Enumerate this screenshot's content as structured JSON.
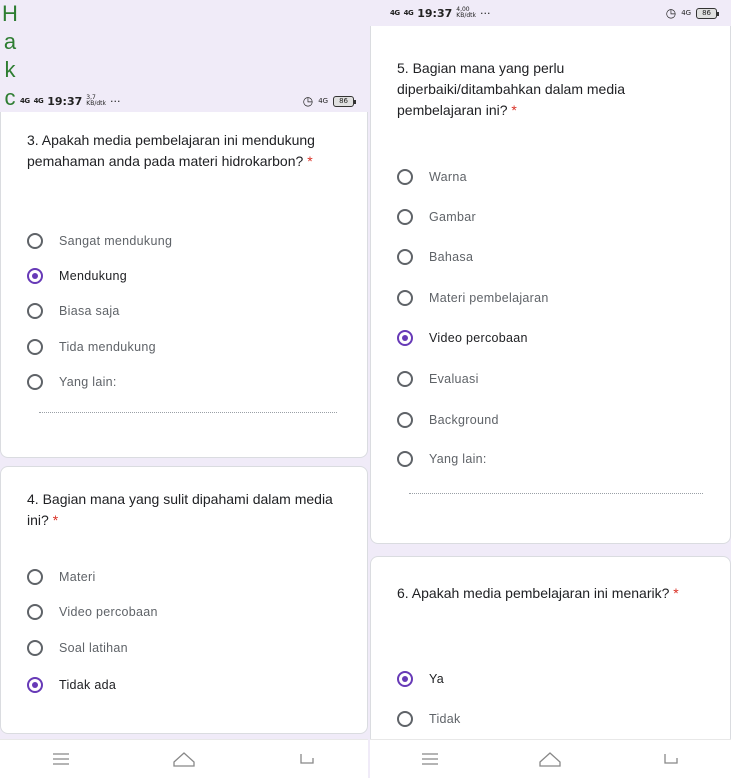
{
  "status": {
    "signal_left": "4G",
    "signal_right": "4G",
    "time": "19:37",
    "speed_left": "3,7\nKB/dtk",
    "speed_right": "4,00\nKB/dtk",
    "dots": "···",
    "network": "4G",
    "battery": "86"
  },
  "watermark": [
    "H",
    "a",
    "k",
    "c"
  ],
  "left": {
    "q3": {
      "title": "3. Apakah media pembelajaran ini mendukung pemahaman anda pada materi hidrokarbon?",
      "required": "*",
      "options": [
        "Sangat mendukung",
        "Mendukung",
        "Biasa saja",
        "Tida mendukung",
        "Yang lain:"
      ],
      "selected_index": 1
    },
    "q4": {
      "title": "4. Bagian mana yang sulit dipahami dalam media ini?",
      "required": "*",
      "options": [
        "Materi",
        "Video percobaan",
        "Soal latihan",
        "Tidak ada"
      ],
      "selected_index": 3
    }
  },
  "right": {
    "q5": {
      "title": "5. Bagian mana yang perlu diperbaiki/ditambahkan dalam media pembelajaran ini?",
      "required": "*",
      "options": [
        "Warna",
        "Gambar",
        "Bahasa",
        "Materi pembelajaran",
        "Video percobaan",
        "Evaluasi",
        "Background",
        "Yang lain:"
      ],
      "selected_index": 4
    },
    "q6": {
      "title": "6. Apakah media pembelajaran ini menarik?",
      "required": "*",
      "options": [
        "Ya",
        "Tidak"
      ],
      "selected_index": 0
    }
  },
  "colors": {
    "accent": "#673ab7",
    "required": "#d93025",
    "background": "#f0ebf8"
  },
  "icons": {
    "menu": "menu-icon",
    "home": "home-icon",
    "back": "back-icon",
    "alarm": "alarm-icon"
  }
}
